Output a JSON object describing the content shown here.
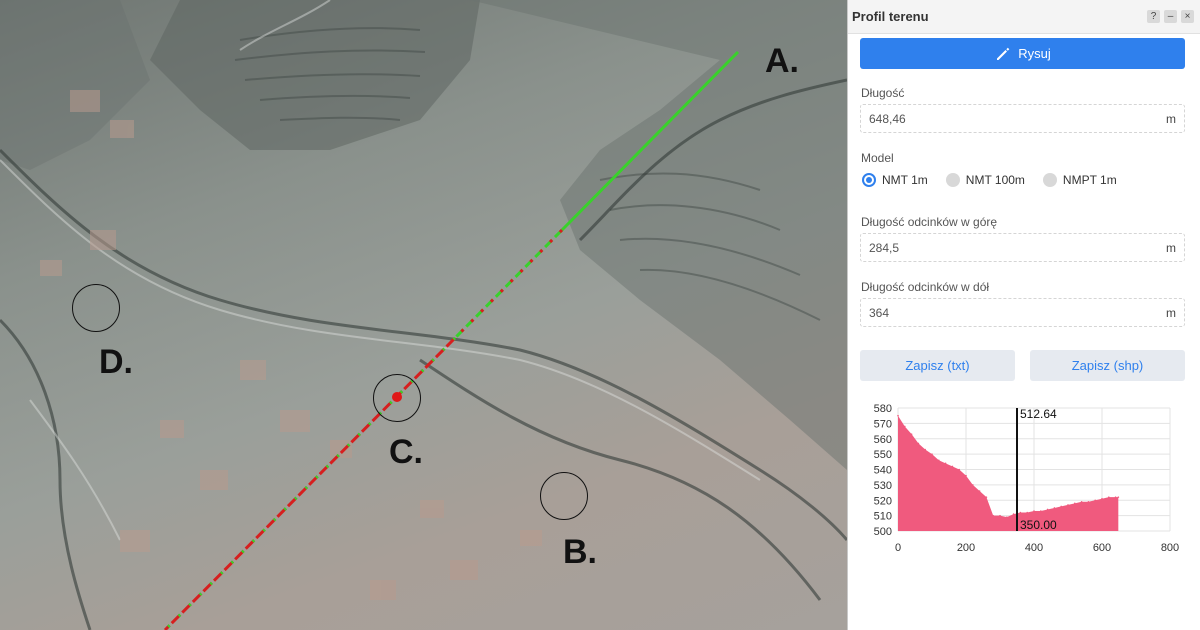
{
  "map": {
    "labels": [
      "A.",
      "B.",
      "C.",
      "D."
    ],
    "colors": {
      "line_green": "#39d12b",
      "line_red": "#d61f1f",
      "point": "#e01818"
    }
  },
  "panel": {
    "title": "Profil terenu",
    "window_buttons": [
      "?",
      "–",
      "×"
    ],
    "draw_button": {
      "label": "Rysuj",
      "icon": "pencil-icon"
    },
    "length": {
      "label": "Długość",
      "value": "648,46",
      "unit": "m"
    },
    "model": {
      "label": "Model",
      "options": [
        "NMT 1m",
        "NMT 100m",
        "NMPT 1m"
      ],
      "selected": "NMT 1m"
    },
    "up_segments": {
      "label": "Długość odcinków w górę",
      "value": "284,5",
      "unit": "m"
    },
    "down_segments": {
      "label": "Długość odcinków w dół",
      "value": "364",
      "unit": "m"
    },
    "save_txt": "Zapisz (txt)",
    "save_shp": "Zapisz (shp)",
    "accent": "#2f80ed"
  },
  "chart_data": {
    "type": "area",
    "x": [
      0,
      20,
      40,
      60,
      80,
      100,
      120,
      140,
      160,
      180,
      200,
      220,
      240,
      260,
      280,
      300,
      320,
      340,
      360,
      380,
      400,
      420,
      440,
      460,
      480,
      500,
      520,
      540,
      560,
      580,
      600,
      620,
      640,
      648
    ],
    "values": [
      575,
      568,
      563,
      557,
      553,
      550,
      546,
      544,
      542,
      540,
      536,
      530,
      526,
      522,
      510,
      510,
      509,
      511,
      512,
      512,
      513,
      513,
      514,
      515,
      516,
      517,
      518,
      519,
      519,
      520,
      521,
      522,
      522,
      522
    ],
    "xlim": [
      0,
      800
    ],
    "ylim": [
      500,
      580
    ],
    "x_ticks": [
      "0",
      "200",
      "400",
      "600",
      "800"
    ],
    "y_ticks": [
      "500",
      "510",
      "520",
      "530",
      "540",
      "550",
      "560",
      "570",
      "580"
    ],
    "cursor": {
      "x": 350,
      "x_label": "350.00",
      "y_label": "512.64"
    },
    "color": "#f05a7e",
    "grid": true
  }
}
